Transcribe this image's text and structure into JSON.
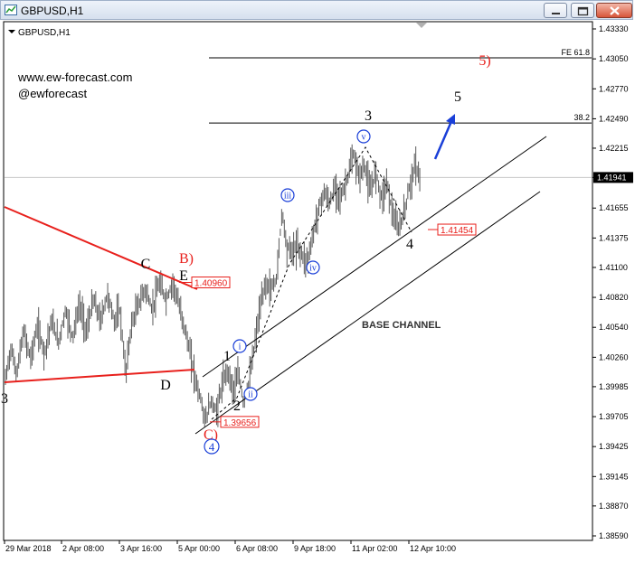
{
  "window": {
    "title": "GBPUSD,H1",
    "icons": [
      "chart-app-icon",
      "minimize-icon",
      "maximize-icon",
      "close-icon"
    ]
  },
  "chart_header": "GBPUSD,H1",
  "watermark": {
    "site": "www.ew-forecast.com",
    "handle": "@ewforecast"
  },
  "colors": {
    "up_bar": "#5a5a5a",
    "red_line": "#e8201c",
    "wave_blue": "#1a3fd8",
    "price_label": "#e8201c",
    "grid_axis": "#000000"
  },
  "chart_data": {
    "type": "ohlc",
    "symbol": "GBPUSD",
    "timeframe": "H1",
    "ylim": [
      1.3857,
      1.4335
    ],
    "y_ticks": [
      "1.43330",
      "1.43050",
      "1.42770",
      "1.42490",
      "1.42215",
      "1.41941",
      "1.41655",
      "1.41375",
      "1.41100",
      "1.40820",
      "1.40540",
      "1.40260",
      "1.39985",
      "1.39705",
      "1.39425",
      "1.39145",
      "1.38870",
      "1.38590"
    ],
    "x_ticks": [
      "29 Mar 2018",
      "2 Apr 08:00",
      "3 Apr 16:00",
      "5 Apr 00:00",
      "6 Apr 08:00",
      "9 Apr 18:00",
      "11 Apr 02:00",
      "12 Apr 10:00"
    ],
    "current_price": "1.41941",
    "price_path": [
      [
        0,
        1.4005
      ],
      [
        0.4,
        1.4035
      ],
      [
        0.8,
        1.401
      ],
      [
        1.3,
        1.405
      ],
      [
        1.8,
        1.4025
      ],
      [
        2.3,
        1.4055
      ],
      [
        2.8,
        1.403
      ],
      [
        3.3,
        1.406
      ],
      [
        3.8,
        1.404
      ],
      [
        4.3,
        1.407
      ],
      [
        4.8,
        1.4045
      ],
      [
        5.3,
        1.4075
      ],
      [
        5.8,
        1.405
      ],
      [
        6.3,
        1.408
      ],
      [
        6.8,
        1.406
      ],
      [
        7.3,
        1.4085
      ],
      [
        7.8,
        1.406
      ],
      [
        8.2,
        1.407
      ],
      [
        8.6,
        1.401
      ],
      [
        9.0,
        1.4055
      ],
      [
        9.5,
        1.4075
      ],
      [
        10.0,
        1.409
      ],
      [
        10.5,
        1.407
      ],
      [
        11.0,
        1.4095
      ],
      [
        11.5,
        1.408
      ],
      [
        12.0,
        1.4096
      ],
      [
        12.4,
        1.4075
      ],
      [
        12.8,
        1.4055
      ],
      [
        13.2,
        1.403
      ],
      [
        13.6,
        1.4005
      ],
      [
        14.0,
        1.3985
      ],
      [
        14.3,
        1.3966
      ],
      [
        14.7,
        1.3985
      ],
      [
        15.1,
        1.3975
      ],
      [
        15.5,
        1.4
      ],
      [
        15.9,
        1.4015
      ],
      [
        16.3,
        1.3995
      ],
      [
        16.7,
        1.401
      ],
      [
        17.0,
        1.3985
      ],
      [
        17.4,
        1.4
      ],
      [
        17.8,
        1.4035
      ],
      [
        18.2,
        1.407
      ],
      [
        18.6,
        1.4095
      ],
      [
        19.0,
        1.409
      ],
      [
        19.4,
        1.41
      ],
      [
        19.8,
        1.4165
      ],
      [
        20.1,
        1.413
      ],
      [
        20.5,
        1.4125
      ],
      [
        20.9,
        1.413
      ],
      [
        21.3,
        1.412
      ],
      [
        21.6,
        1.4115
      ],
      [
        22.0,
        1.414
      ],
      [
        22.4,
        1.4165
      ],
      [
        22.8,
        1.418
      ],
      [
        23.2,
        1.417
      ],
      [
        23.6,
        1.4185
      ],
      [
        24.0,
        1.4175
      ],
      [
        24.5,
        1.4195
      ],
      [
        24.9,
        1.4215
      ],
      [
        25.3,
        1.4195
      ],
      [
        25.7,
        1.4205
      ],
      [
        26.1,
        1.418
      ],
      [
        26.5,
        1.42
      ],
      [
        26.9,
        1.4175
      ],
      [
        27.3,
        1.419
      ],
      [
        27.7,
        1.416
      ],
      [
        28.1,
        1.4145
      ],
      [
        28.5,
        1.416
      ],
      [
        28.9,
        1.4185
      ],
      [
        29.3,
        1.4205
      ],
      [
        29.7,
        1.4194
      ]
    ],
    "horizontal_levels": [
      {
        "label": "FE 61.8",
        "value": 1.4306
      },
      {
        "label": "38.2",
        "value": 1.4245
      }
    ],
    "price_labels": [
      {
        "text": "1.40960",
        "value": 1.4096
      },
      {
        "text": "1.39656",
        "value": 1.39656
      },
      {
        "text": "1.41454",
        "value": 1.41454
      }
    ],
    "channel_label": "BASE CHANNEL",
    "wave_labels_black": [
      "C",
      "E",
      "D",
      "1",
      "2",
      "3",
      "4",
      "5"
    ],
    "wave_labels_red": [
      "B)",
      "C)",
      "5)"
    ],
    "wave_labels_circled_blue": [
      "i",
      "ii",
      "iii",
      "iv",
      "v",
      "4"
    ],
    "left_edge_label": "3"
  }
}
